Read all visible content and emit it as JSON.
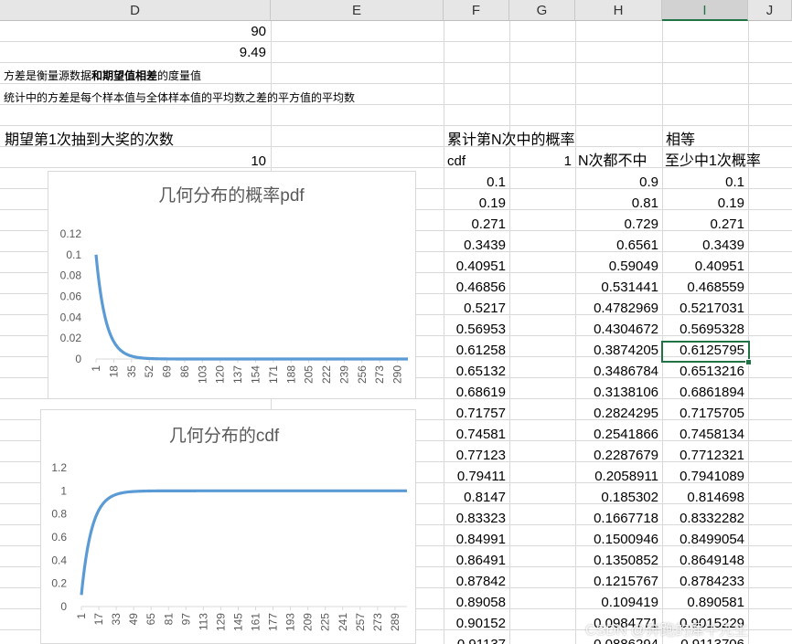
{
  "columns": [
    "D",
    "E",
    "F",
    "G",
    "H",
    "I",
    "J"
  ],
  "selected_column": "I",
  "cells": {
    "d_values": [
      "90",
      "9.49"
    ],
    "variance_note_1_a": "方差是衡量源数据",
    "variance_note_1_b": "和期望值相差",
    "variance_note_1_c": "的度量值",
    "variance_note_2": "统计中的方差是每个样本值与全体样本值的平均数之差的平方值的平均数",
    "expect_label": "期望第1次抽到大奖的次数",
    "expect_value": "10",
    "cumulative_label": "累计第N次中的概率",
    "equal_label": "相等",
    "cdf_label": "cdf",
    "g_value": "1",
    "never_label": "N次都不中",
    "atleast_label": "至少中1次概率"
  },
  "table": {
    "F": [
      "0.1",
      "0.19",
      "0.271",
      "0.3439",
      "0.40951",
      "0.46856",
      "0.5217",
      "0.56953",
      "0.61258",
      "0.65132",
      "0.68619",
      "0.71757",
      "0.74581",
      "0.77123",
      "0.79411",
      "0.8147",
      "0.83323",
      "0.84991",
      "0.86491",
      "0.87842",
      "0.89058",
      "0.90152",
      "0.91137"
    ],
    "H": [
      "0.9",
      "0.81",
      "0.729",
      "0.6561",
      "0.59049",
      "0.531441",
      "0.4782969",
      "0.4304672",
      "0.3874205",
      "0.3486784",
      "0.3138106",
      "0.2824295",
      "0.2541866",
      "0.2287679",
      "0.2058911",
      "0.185302",
      "0.1667718",
      "0.1500946",
      "0.1350852",
      "0.1215767",
      "0.109419",
      "0.0984771",
      "0.0886294"
    ],
    "I": [
      "0.1",
      "0.19",
      "0.271",
      "0.3439",
      "0.40951",
      "0.468559",
      "0.5217031",
      "0.5695328",
      "0.6125795",
      "0.6513216",
      "0.6861894",
      "0.7175705",
      "0.7458134",
      "0.7712321",
      "0.7941089",
      "0.814698",
      "0.8332282",
      "0.8499054",
      "0.8649148",
      "0.8784233",
      "0.890581",
      "0.9015229",
      "0.9113706"
    ]
  },
  "chart_data": [
    {
      "type": "line",
      "title": "几何分布的概率pdf",
      "x_tick_labels": [
        "1",
        "18",
        "35",
        "52",
        "69",
        "86",
        "103",
        "120",
        "137",
        "154",
        "171",
        "188",
        "205",
        "222",
        "239",
        "256",
        "273",
        "290"
      ],
      "y_tick_labels": [
        "0",
        "0.02",
        "0.04",
        "0.06",
        "0.08",
        "0.1",
        "0.12"
      ],
      "ylim": [
        0,
        0.12
      ],
      "x_range": [
        1,
        300
      ],
      "series": [
        {
          "formula": "0.1*0.9^(n-1)",
          "values_first": [
            0.1,
            0.09,
            0.081,
            0.0729,
            0.06561,
            0.059049,
            0.0531441,
            0.04782969,
            0.04304672,
            0.03874205
          ]
        }
      ],
      "color": "#5b9bd5",
      "grid": false,
      "legend": "none"
    },
    {
      "type": "line",
      "title": "几何分布的cdf",
      "x_tick_labels": [
        "1",
        "17",
        "33",
        "49",
        "65",
        "81",
        "97",
        "113",
        "129",
        "145",
        "161",
        "177",
        "193",
        "209",
        "225",
        "241",
        "257",
        "273",
        "289"
      ],
      "y_tick_labels": [
        "0",
        "0.2",
        "0.4",
        "0.6",
        "0.8",
        "1",
        "1.2"
      ],
      "ylim": [
        0,
        1.2
      ],
      "x_range": [
        1,
        300
      ],
      "series": [
        {
          "formula": "1-0.9^n",
          "values_first": [
            0.1,
            0.19,
            0.271,
            0.3439,
            0.40951,
            0.468559,
            0.5217031,
            0.5695328,
            0.6125795,
            0.6513216
          ]
        }
      ],
      "color": "#5b9bd5",
      "grid": false,
      "legend": "none"
    }
  ],
  "watermark": "CSDN @奔跑的犀牛先生"
}
